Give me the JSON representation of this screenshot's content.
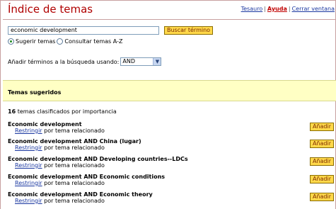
{
  "header": {
    "title": "Índice de temas",
    "links": [
      "Tesauro",
      "Ayuda",
      "Cerrar ventana"
    ],
    "separator": "|"
  },
  "search": {
    "value": "economic development",
    "button_label": "Buscar término"
  },
  "mode": {
    "option1": "Sugerir temas",
    "option2": "Consultar temas A-Z",
    "selected": "Sugerir temas"
  },
  "operator": {
    "label": "Añadir términos a la búsqueda usando:",
    "value": "AND"
  },
  "suggested": {
    "heading": "Temas sugeridos",
    "count": "16",
    "count_suffix": "temas clasificados por importancia"
  },
  "results": [
    {
      "title": "Economic development",
      "link": "Restringir",
      "suffix": "por tema relacionado",
      "add": "Añadir"
    },
    {
      "title": "Economic development AND China (lugar)",
      "link": "Restringir",
      "suffix": "por tema relacionado",
      "add": "Añadir"
    },
    {
      "title": "Economic development AND Developing countries--LDCs",
      "link": "Restringir",
      "suffix": "por tema relacionado",
      "add": "Añadir"
    },
    {
      "title": "Economic development AND Economic conditions",
      "link": "Restringir",
      "suffix": "por tema relacionado",
      "add": "Añadir"
    },
    {
      "title": "Economic development AND Economic theory",
      "link": "Restringir",
      "suffix": "por tema relacionado",
      "add": "Añadir"
    }
  ]
}
